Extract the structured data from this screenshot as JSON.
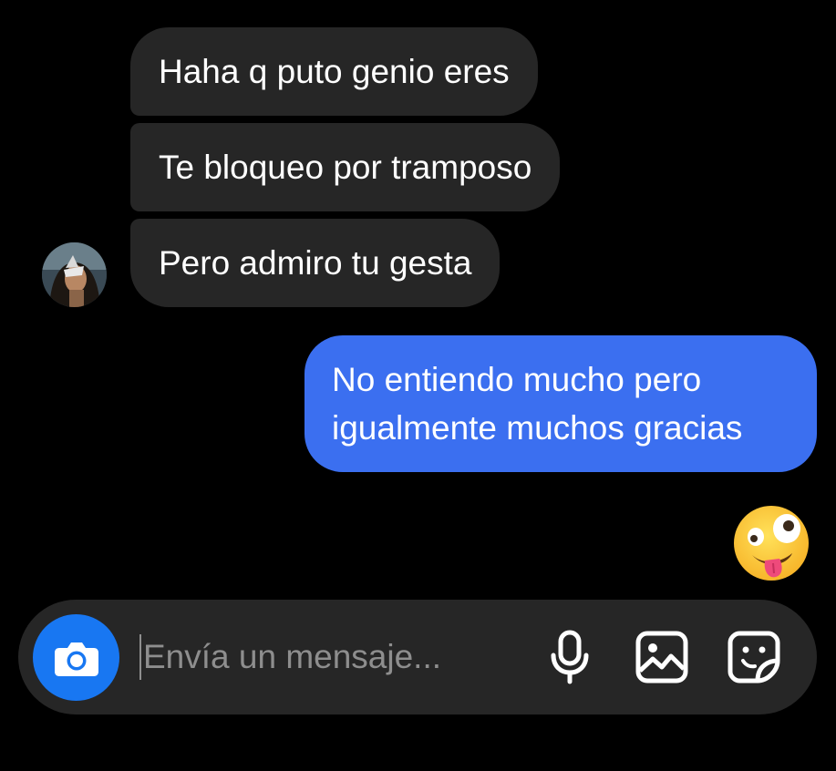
{
  "messages": {
    "received": [
      {
        "text": "Haha q puto genio eres"
      },
      {
        "text": "Te bloqueo por tramposo"
      },
      {
        "text": "Pero admiro tu gesta"
      }
    ],
    "sent": [
      {
        "text": "No entiendo mucho pero igualmente muchos gracias"
      }
    ],
    "reaction_emoji": "zany-face-emoji"
  },
  "composer": {
    "placeholder": "Envía un mensaje...",
    "icons": [
      "camera-icon",
      "microphone-icon",
      "gallery-icon",
      "sticker-icon"
    ]
  },
  "colors": {
    "background": "#000000",
    "received_bubble": "#262626",
    "sent_bubble": "#3b6ff0",
    "camera_button": "#1877f2",
    "placeholder": "#8e8e8e"
  }
}
